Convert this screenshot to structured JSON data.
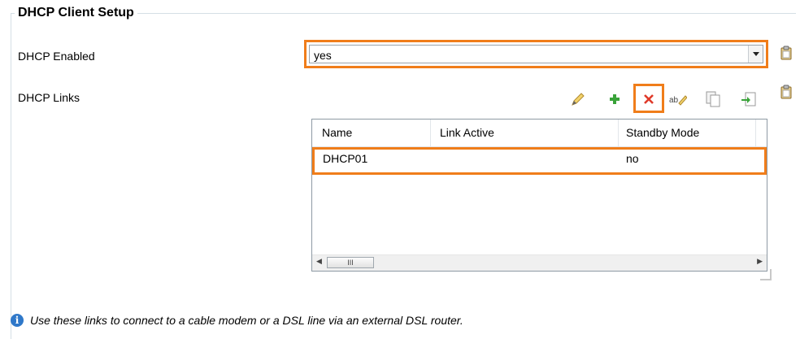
{
  "section": {
    "title": "DHCP Client Setup"
  },
  "dhcp_enabled": {
    "label": "DHCP Enabled",
    "value": "yes"
  },
  "dhcp_links": {
    "label": "DHCP Links",
    "toolbar": [
      "edit-pencil-icon",
      "add-plus-icon",
      "delete-x-icon",
      "rename-icon",
      "copy-icon",
      "paste-icon"
    ],
    "columns": [
      "Name",
      "Link Active",
      "Standby Mode"
    ],
    "rows": [
      {
        "name": "DHCP01",
        "link_active": "",
        "standby_mode": "no"
      }
    ],
    "scrollbar_thumb": "III"
  },
  "info": {
    "text": "Use these links to connect to a cable modem or a DSL line via an external DSL router."
  },
  "colors": {
    "highlight": "#f07d1a",
    "info": "#2f78c9",
    "add": "#3aa33a",
    "delete": "#e03a2a"
  }
}
